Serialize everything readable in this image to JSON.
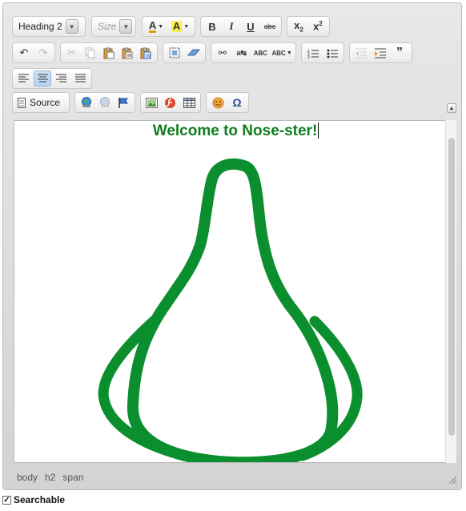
{
  "toolbar": {
    "format_value": "Heading 2",
    "size_placeholder": "Size",
    "source_label": "Source"
  },
  "content": {
    "heading": "Welcome to Nose-ster!"
  },
  "pathbar": [
    "body",
    "h2",
    "span"
  ],
  "searchable": {
    "label": "Searchable",
    "checked": true
  },
  "colors": {
    "heading": "#107d1e",
    "drawing_stroke": "#0b8f2e"
  }
}
